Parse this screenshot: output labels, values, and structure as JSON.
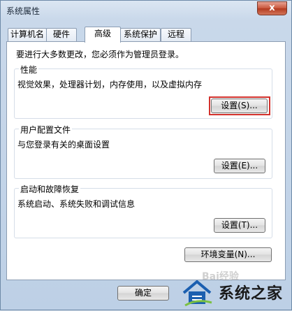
{
  "window": {
    "title": "系统属性",
    "close_label": "x"
  },
  "tabs": [
    {
      "label": "计算机名",
      "active": false
    },
    {
      "label": "硬件",
      "active": false
    },
    {
      "label": "高级",
      "active": true
    },
    {
      "label": "系统保护",
      "active": false
    },
    {
      "label": "远程",
      "active": false
    }
  ],
  "advanced": {
    "admin_notice": "要进行大多数更改，您必须作为管理员登录。",
    "performance": {
      "title": "性能",
      "description": "视觉效果，处理器计划，内存使用，以及虚拟内存",
      "button": "设置(S)..."
    },
    "user_profiles": {
      "title": "用户配置文件",
      "description": "与您登录有关的桌面设置",
      "button": "设置(E)..."
    },
    "startup_recovery": {
      "title": "启动和故障恢复",
      "description": "系统启动、系统失败和调试信息",
      "button": "设置(T)..."
    },
    "env_vars_button": "环境变量(N)..."
  },
  "footer": {
    "ok_button": "确定"
  },
  "watermark": {
    "text": "系统之家",
    "bg_text": "Bai经验"
  },
  "colors": {
    "highlight_box": "#d2322d",
    "close_button": "#c8553a"
  }
}
